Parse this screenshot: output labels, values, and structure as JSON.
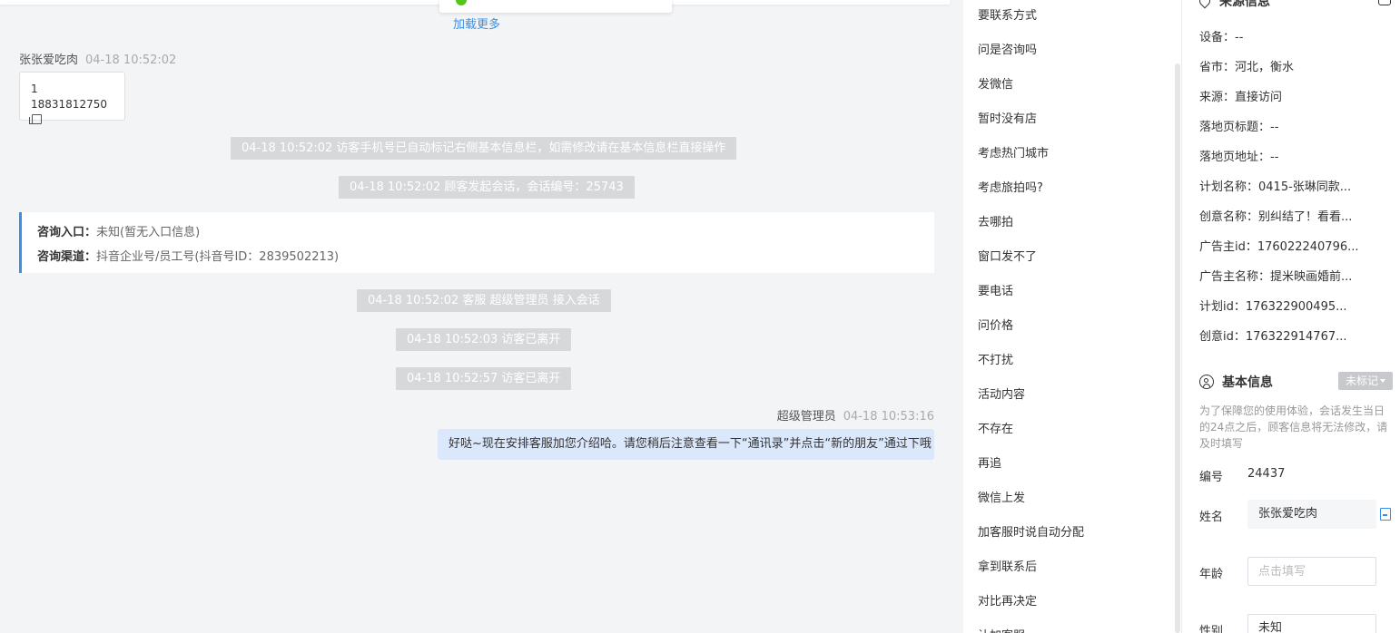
{
  "chat": {
    "load_more": "加载更多",
    "visitor_name": "张张爱吃肉",
    "visitor_time": "04-18 10:52:02",
    "visitor_msg_line1": "1",
    "visitor_msg_line2": "18831812750",
    "sys1": "04-18 10:52:02 访客手机号已自动标记右侧基本信息栏，如需修改请在基本信息栏直接操作",
    "sys2": "04-18 10:52:02 顾客发起会话，会话编号：25743",
    "source": {
      "entry_label": "咨询入口：",
      "entry_value": "未知(暂无入口信息)",
      "channel_label": "咨询渠道：",
      "channel_value": "抖音企业号/员工号(抖音号ID：2839502213)"
    },
    "sys3": "04-18 10:52:02 客服 超级管理员 接入会话",
    "sys4": "04-18 10:52:03 访客已离开",
    "sys5": "04-18 10:52:57 访客已离开",
    "agent_name": "超级管理员",
    "agent_time": "04-18 10:53:16",
    "agent_msg": "好哒~现在安排客服加您介绍哈。请您稍后注意查看一下“通讯录”并点击“新的朋友”通过下哦"
  },
  "phrases": [
    "要联系方式",
    "问是咨询吗",
    "发微信",
    "暂时没有店",
    "考虑热门城市",
    "考虑旅拍吗?",
    "去哪拍",
    "窗口发不了",
    "要电话",
    "问价格",
    "不打扰",
    "活动内容",
    "不存在",
    "再追",
    "微信上发",
    "加客服时说自动分配",
    "拿到联系后",
    "对比再决定",
    "让加客服"
  ],
  "source_info": {
    "title": "来源信息",
    "rows": [
      "设备：--",
      "省市：河北，衡水",
      "来源：直接访问",
      "落地页标题：--",
      "落地页地址：--",
      "计划名称：0415-张琳同款...",
      "创意名称：别纠结了！看看...",
      "广告主id：176022240796...",
      "广告主名称：提米映画婚前...",
      "计划id：176322900495...",
      "创意id：176322914767..."
    ]
  },
  "basic_info": {
    "title": "基本信息",
    "mark_label": "未标记",
    "hint": "为了保障您的使用体验，会话发生当日的24点之后，顾客信息将无法修改，请及时填写",
    "id_label": "编号",
    "id_value": "24437",
    "name_label": "姓名",
    "name_value": "张张爱吃肉",
    "age_label": "年龄",
    "age_placeholder": "点击填写",
    "gender_label": "性别",
    "gender_value": "未知"
  }
}
